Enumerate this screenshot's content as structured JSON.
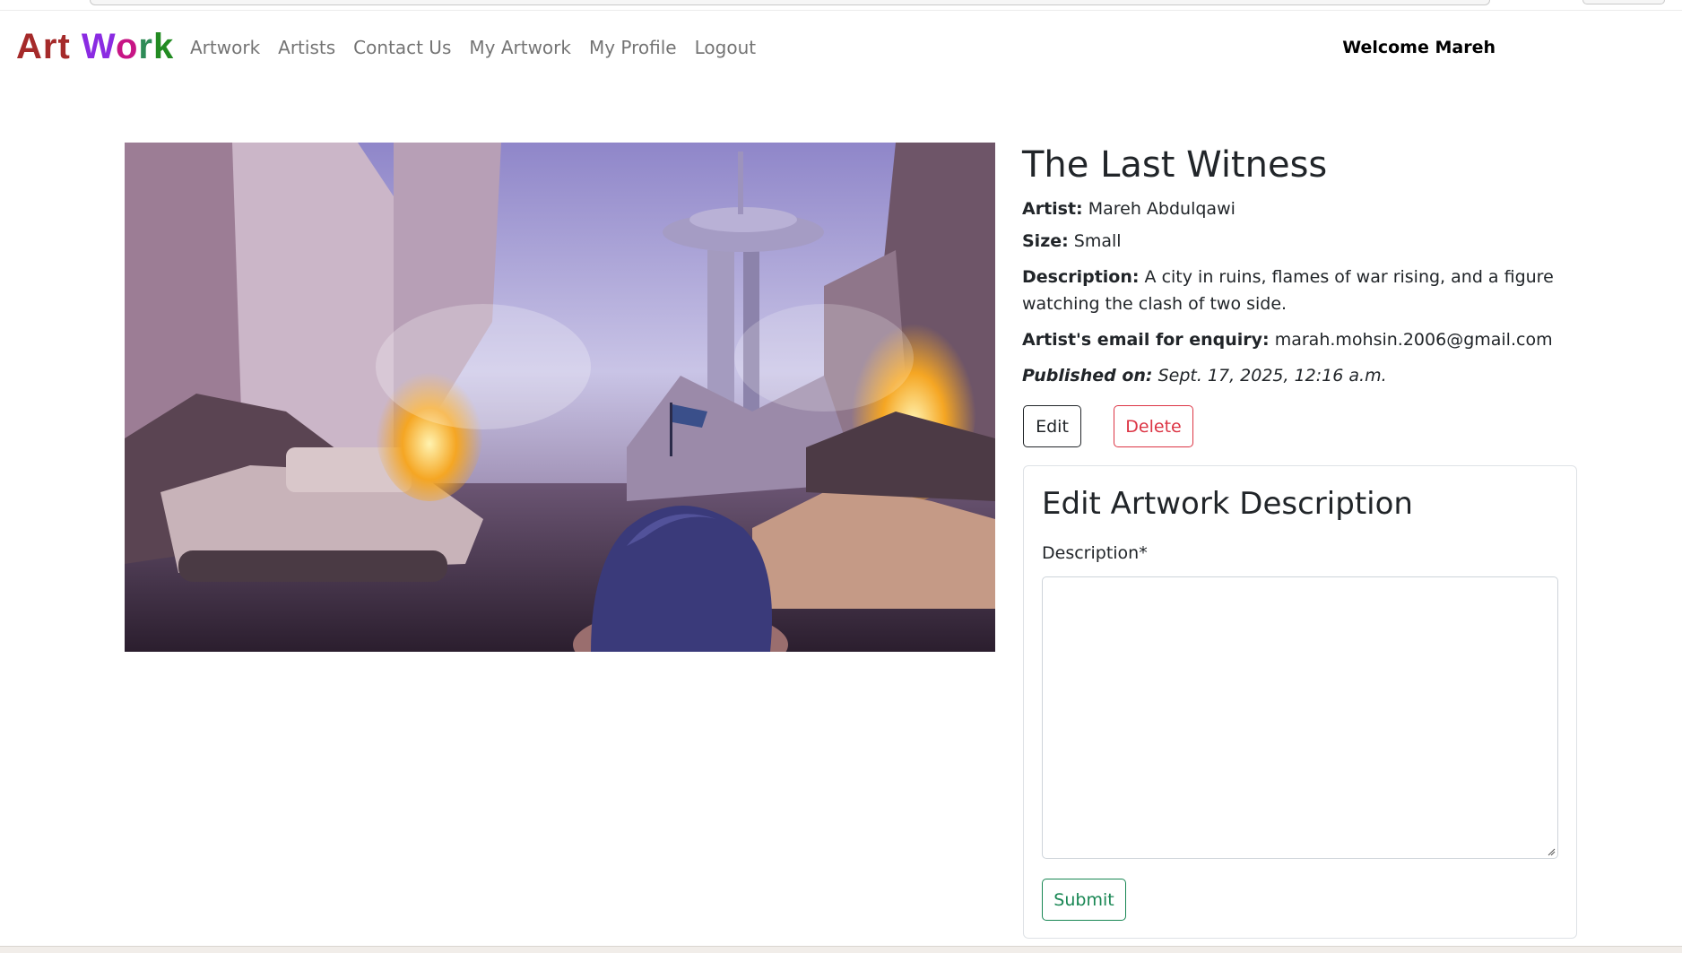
{
  "brand": {
    "word1": "Art",
    "word2_parts": [
      "W",
      "o",
      "r",
      "k"
    ]
  },
  "nav": {
    "items": [
      "Artwork",
      "Artists",
      "Contact Us",
      "My Artwork",
      "My Profile",
      "Logout"
    ],
    "welcome": "Welcome Mareh"
  },
  "artwork": {
    "title": "The Last Witness",
    "artist_label": "Artist:",
    "artist": "Mareh Abdulqawi",
    "size_label": "Size:",
    "size": "Small",
    "description_label": "Description:",
    "description": "A city in ruins, flames of war rising, and a figure watching the clash of two side.",
    "email_label": "Artist's email for enquiry:",
    "email": "marah.mohsin.2006@gmail.com",
    "published_label": "Published on:",
    "published": "Sept. 17, 2025, 12:16 a.m."
  },
  "actions": {
    "edit": "Edit",
    "delete": "Delete"
  },
  "form": {
    "title": "Edit Artwork Description",
    "field_label": "Description*",
    "field_value": "",
    "submit": "Submit"
  },
  "colors": {
    "brand_art": "#a52a2a",
    "brand_w": "#8a2be2",
    "brand_o": "#c71585",
    "brand_r": "#2e8b57",
    "brand_k": "#228b22",
    "danger": "#dc3545",
    "success": "#198754"
  }
}
